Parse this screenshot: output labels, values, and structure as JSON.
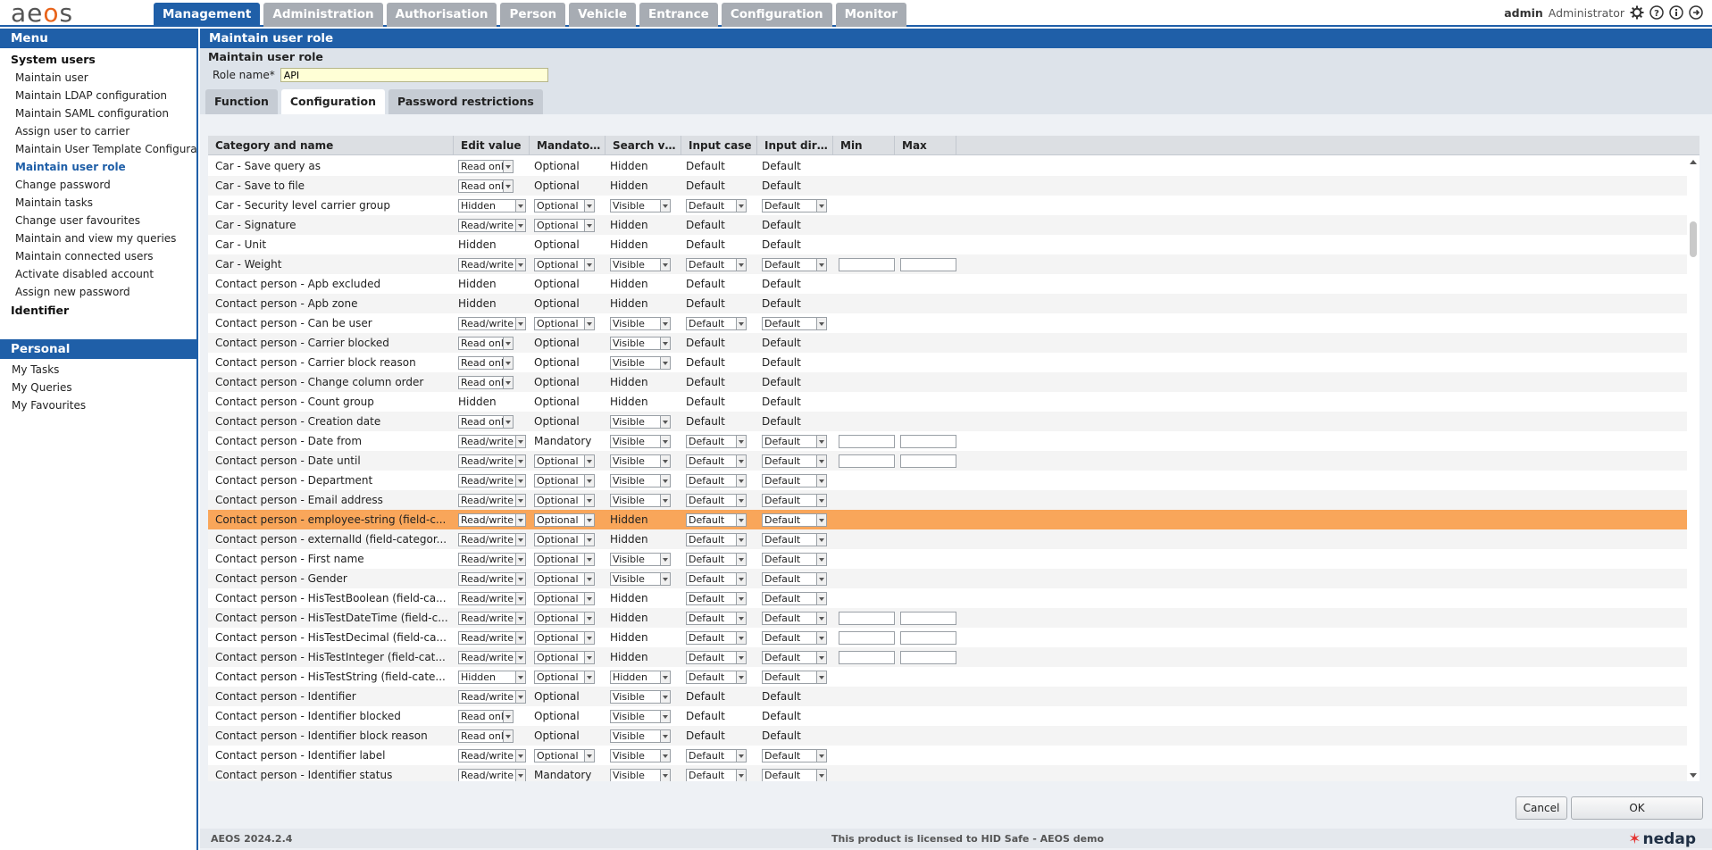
{
  "logo": {
    "text_a": "ae",
    "text_b": "o",
    "text_c": "s"
  },
  "nav": {
    "tabs": [
      "Management",
      "Administration",
      "Authorisation",
      "Person",
      "Vehicle",
      "Entrance",
      "Configuration",
      "Monitor"
    ],
    "active": "Management"
  },
  "user": {
    "name": "admin",
    "role": "Administrator"
  },
  "sidebar": {
    "menu_title": "Menu",
    "group1": "System users",
    "items": [
      "Maintain user",
      "Maintain LDAP configuration",
      "Maintain SAML configuration",
      "Assign user to carrier",
      "Maintain User Template Configuration",
      "Maintain user role",
      "Change password",
      "Maintain tasks",
      "Change user favourites",
      "Maintain and view my queries",
      "Maintain connected users",
      "Activate disabled account",
      "Assign new password"
    ],
    "active_item": "Maintain user role",
    "group2": "Identifier",
    "personal_title": "Personal",
    "personal_items": [
      "My Tasks",
      "My Queries",
      "My Favourites"
    ]
  },
  "main": {
    "title": "Maintain user role",
    "subtitle": "Maintain user role",
    "role_label": "Role name*",
    "role_value": "API",
    "tabs": [
      "Function",
      "Configuration",
      "Password restrictions"
    ],
    "active_tab": "Configuration"
  },
  "grid": {
    "columns": [
      "Category and name",
      "Edit value",
      "Mandatory v...",
      "Search value",
      "Input case",
      "Input directi...",
      "Min",
      "Max"
    ],
    "rows": [
      {
        "name": "Car - Save query as",
        "edit": "Read only",
        "edit_sel": true,
        "mand": "Optional",
        "mand_sel": false,
        "search": "Hidden",
        "search_sel": false,
        "icase": "Default",
        "icase_sel": false,
        "idir": "Default",
        "idir_sel": false,
        "minmax": false
      },
      {
        "name": "Car - Save to file",
        "edit": "Read only",
        "edit_sel": true,
        "mand": "Optional",
        "mand_sel": false,
        "search": "Hidden",
        "search_sel": false,
        "icase": "Default",
        "icase_sel": false,
        "idir": "Default",
        "idir_sel": false,
        "minmax": false
      },
      {
        "name": "Car - Security level carrier group",
        "edit": "Hidden",
        "edit_sel": true,
        "mand": "Optional",
        "mand_sel": true,
        "search": "Visible",
        "search_sel": true,
        "icase": "Default",
        "icase_sel": true,
        "idir": "Default",
        "idir_sel": true,
        "minmax": false
      },
      {
        "name": "Car - Signature",
        "edit": "Read/write",
        "edit_sel": true,
        "mand": "Optional",
        "mand_sel": true,
        "search": "Hidden",
        "search_sel": false,
        "icase": "Default",
        "icase_sel": false,
        "idir": "Default",
        "idir_sel": false,
        "minmax": false
      },
      {
        "name": "Car - Unit",
        "edit": "Hidden",
        "edit_sel": false,
        "mand": "Optional",
        "mand_sel": false,
        "search": "Hidden",
        "search_sel": false,
        "icase": "Default",
        "icase_sel": false,
        "idir": "Default",
        "idir_sel": false,
        "minmax": false
      },
      {
        "name": "Car - Weight",
        "edit": "Read/write",
        "edit_sel": true,
        "mand": "Optional",
        "mand_sel": true,
        "search": "Visible",
        "search_sel": true,
        "icase": "Default",
        "icase_sel": true,
        "idir": "Default",
        "idir_sel": true,
        "minmax": true
      },
      {
        "name": "Contact person - Apb excluded",
        "edit": "Hidden",
        "edit_sel": false,
        "mand": "Optional",
        "mand_sel": false,
        "search": "Hidden",
        "search_sel": false,
        "icase": "Default",
        "icase_sel": false,
        "idir": "Default",
        "idir_sel": false,
        "minmax": false
      },
      {
        "name": "Contact person - Apb zone",
        "edit": "Hidden",
        "edit_sel": false,
        "mand": "Optional",
        "mand_sel": false,
        "search": "Hidden",
        "search_sel": false,
        "icase": "Default",
        "icase_sel": false,
        "idir": "Default",
        "idir_sel": false,
        "minmax": false
      },
      {
        "name": "Contact person - Can be user",
        "edit": "Read/write",
        "edit_sel": true,
        "mand": "Optional",
        "mand_sel": true,
        "search": "Visible",
        "search_sel": true,
        "icase": "Default",
        "icase_sel": true,
        "idir": "Default",
        "idir_sel": true,
        "minmax": false
      },
      {
        "name": "Contact person - Carrier blocked",
        "edit": "Read only",
        "edit_sel": true,
        "mand": "Optional",
        "mand_sel": false,
        "search": "Visible",
        "search_sel": true,
        "icase": "Default",
        "icase_sel": false,
        "idir": "Default",
        "idir_sel": false,
        "minmax": false
      },
      {
        "name": "Contact person - Carrier block reason",
        "edit": "Read only",
        "edit_sel": true,
        "mand": "Optional",
        "mand_sel": false,
        "search": "Visible",
        "search_sel": true,
        "icase": "Default",
        "icase_sel": false,
        "idir": "Default",
        "idir_sel": false,
        "minmax": false
      },
      {
        "name": "Contact person - Change column order",
        "edit": "Read only",
        "edit_sel": true,
        "mand": "Optional",
        "mand_sel": false,
        "search": "Hidden",
        "search_sel": false,
        "icase": "Default",
        "icase_sel": false,
        "idir": "Default",
        "idir_sel": false,
        "minmax": false
      },
      {
        "name": "Contact person - Count group",
        "edit": "Hidden",
        "edit_sel": false,
        "mand": "Optional",
        "mand_sel": false,
        "search": "Hidden",
        "search_sel": false,
        "icase": "Default",
        "icase_sel": false,
        "idir": "Default",
        "idir_sel": false,
        "minmax": false
      },
      {
        "name": "Contact person - Creation date",
        "edit": "Read only",
        "edit_sel": true,
        "mand": "Optional",
        "mand_sel": false,
        "search": "Visible",
        "search_sel": true,
        "icase": "Default",
        "icase_sel": false,
        "idir": "Default",
        "idir_sel": false,
        "minmax": false
      },
      {
        "name": "Contact person - Date from",
        "edit": "Read/write",
        "edit_sel": true,
        "mand": "Mandatory",
        "mand_sel": false,
        "search": "Visible",
        "search_sel": true,
        "icase": "Default",
        "icase_sel": true,
        "idir": "Default",
        "idir_sel": true,
        "minmax": true
      },
      {
        "name": "Contact person - Date until",
        "edit": "Read/write",
        "edit_sel": true,
        "mand": "Optional",
        "mand_sel": true,
        "search": "Visible",
        "search_sel": true,
        "icase": "Default",
        "icase_sel": true,
        "idir": "Default",
        "idir_sel": true,
        "minmax": true
      },
      {
        "name": "Contact person - Department",
        "edit": "Read/write",
        "edit_sel": true,
        "mand": "Optional",
        "mand_sel": true,
        "search": "Visible",
        "search_sel": true,
        "icase": "Default",
        "icase_sel": true,
        "idir": "Default",
        "idir_sel": true,
        "minmax": false
      },
      {
        "name": "Contact person - Email address",
        "edit": "Read/write",
        "edit_sel": true,
        "mand": "Optional",
        "mand_sel": true,
        "search": "Visible",
        "search_sel": true,
        "icase": "Default",
        "icase_sel": true,
        "idir": "Default",
        "idir_sel": true,
        "minmax": false
      },
      {
        "name": "Contact person - employee-string (field-c...",
        "edit": "Read/write",
        "edit_sel": true,
        "mand": "Optional",
        "mand_sel": true,
        "search": "Hidden",
        "search_sel": false,
        "icase": "Default",
        "icase_sel": true,
        "idir": "Default",
        "idir_sel": true,
        "minmax": false,
        "highlight": true
      },
      {
        "name": "Contact person - externalId (field-categor...",
        "edit": "Read/write",
        "edit_sel": true,
        "mand": "Optional",
        "mand_sel": true,
        "search": "Hidden",
        "search_sel": false,
        "icase": "Default",
        "icase_sel": true,
        "idir": "Default",
        "idir_sel": true,
        "minmax": false
      },
      {
        "name": "Contact person - First name",
        "edit": "Read/write",
        "edit_sel": true,
        "mand": "Optional",
        "mand_sel": true,
        "search": "Visible",
        "search_sel": true,
        "icase": "Default",
        "icase_sel": true,
        "idir": "Default",
        "idir_sel": true,
        "minmax": false
      },
      {
        "name": "Contact person - Gender",
        "edit": "Read/write",
        "edit_sel": true,
        "mand": "Optional",
        "mand_sel": true,
        "search": "Visible",
        "search_sel": true,
        "icase": "Default",
        "icase_sel": true,
        "idir": "Default",
        "idir_sel": true,
        "minmax": false
      },
      {
        "name": "Contact person - HisTestBoolean (field-ca...",
        "edit": "Read/write",
        "edit_sel": true,
        "mand": "Optional",
        "mand_sel": true,
        "search": "Hidden",
        "search_sel": false,
        "icase": "Default",
        "icase_sel": true,
        "idir": "Default",
        "idir_sel": true,
        "minmax": false
      },
      {
        "name": "Contact person - HisTestDateTime (field-c...",
        "edit": "Read/write",
        "edit_sel": true,
        "mand": "Optional",
        "mand_sel": true,
        "search": "Hidden",
        "search_sel": false,
        "icase": "Default",
        "icase_sel": true,
        "idir": "Default",
        "idir_sel": true,
        "minmax": true
      },
      {
        "name": "Contact person - HisTestDecimal (field-ca...",
        "edit": "Read/write",
        "edit_sel": true,
        "mand": "Optional",
        "mand_sel": true,
        "search": "Hidden",
        "search_sel": false,
        "icase": "Default",
        "icase_sel": true,
        "idir": "Default",
        "idir_sel": true,
        "minmax": true
      },
      {
        "name": "Contact person - HisTestInteger (field-cat...",
        "edit": "Read/write",
        "edit_sel": true,
        "mand": "Optional",
        "mand_sel": true,
        "search": "Hidden",
        "search_sel": false,
        "icase": "Default",
        "icase_sel": true,
        "idir": "Default",
        "idir_sel": true,
        "minmax": true
      },
      {
        "name": "Contact person - HisTestString (field-cate...",
        "edit": "Hidden",
        "edit_sel": true,
        "mand": "Optional",
        "mand_sel": true,
        "search": "Hidden",
        "search_sel": true,
        "icase": "Default",
        "icase_sel": true,
        "idir": "Default",
        "idir_sel": true,
        "minmax": false
      },
      {
        "name": "Contact person - Identifier",
        "edit": "Read/write",
        "edit_sel": true,
        "mand": "Optional",
        "mand_sel": false,
        "search": "Visible",
        "search_sel": true,
        "icase": "Default",
        "icase_sel": false,
        "idir": "Default",
        "idir_sel": false,
        "minmax": false
      },
      {
        "name": "Contact person - Identifier blocked",
        "edit": "Read only",
        "edit_sel": true,
        "mand": "Optional",
        "mand_sel": false,
        "search": "Visible",
        "search_sel": true,
        "icase": "Default",
        "icase_sel": false,
        "idir": "Default",
        "idir_sel": false,
        "minmax": false
      },
      {
        "name": "Contact person - Identifier block reason",
        "edit": "Read only",
        "edit_sel": true,
        "mand": "Optional",
        "mand_sel": false,
        "search": "Visible",
        "search_sel": true,
        "icase": "Default",
        "icase_sel": false,
        "idir": "Default",
        "idir_sel": false,
        "minmax": false
      },
      {
        "name": "Contact person - Identifier label",
        "edit": "Read/write",
        "edit_sel": true,
        "mand": "Optional",
        "mand_sel": true,
        "search": "Visible",
        "search_sel": true,
        "icase": "Default",
        "icase_sel": true,
        "idir": "Default",
        "idir_sel": true,
        "minmax": false
      },
      {
        "name": "Contact person - Identifier status",
        "edit": "Read/write",
        "edit_sel": true,
        "mand": "Mandatory",
        "mand_sel": false,
        "search": "Visible",
        "search_sel": true,
        "icase": "Default",
        "icase_sel": true,
        "idir": "Default",
        "idir_sel": true,
        "minmax": false
      }
    ]
  },
  "buttons": {
    "cancel": "Cancel",
    "ok": "OK"
  },
  "footer": {
    "version": "AEOS 2024.2.4",
    "license": "This product is licensed to HID Safe - AEOS demo",
    "brand": "nedap"
  },
  "colors": {
    "primary": "#1f5fa8",
    "highlight_row": "#f9a65a",
    "logo_accent": "#e8631a"
  }
}
